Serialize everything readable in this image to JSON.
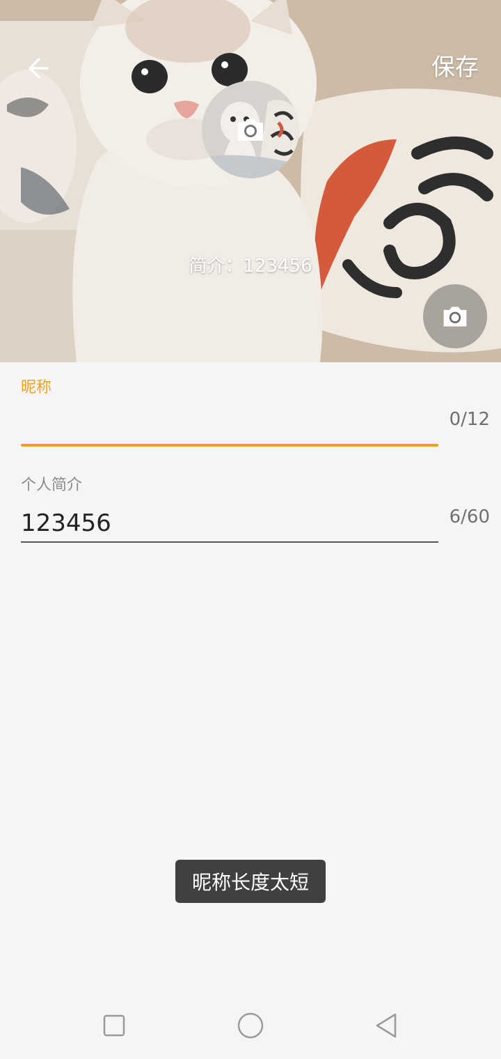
{
  "header": {
    "save_label": "保存",
    "bio_preview": "简介：123456"
  },
  "form": {
    "nickname": {
      "label": "昵称",
      "value": "",
      "counter": "0/12"
    },
    "intro": {
      "label": "个人简介",
      "value": "123456",
      "counter": "6/60"
    }
  },
  "toast": {
    "message": "昵称长度太短"
  },
  "colors": {
    "accent": "#f0a11e",
    "toast_bg": "#404040",
    "page_bg": "#f5f5f5"
  },
  "icons": {
    "back": "arrow-left-icon",
    "avatar_camera": "camera-icon",
    "cover_camera": "camera-icon",
    "nav_recent": "square-icon",
    "nav_home": "circle-icon",
    "nav_back": "triangle-icon"
  }
}
